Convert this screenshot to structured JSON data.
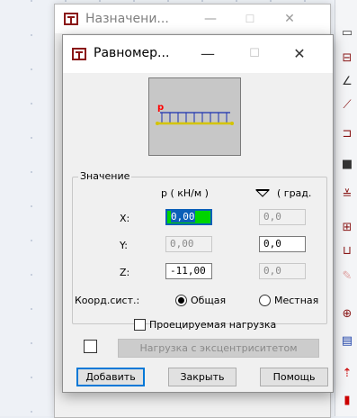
{
  "background_window": {
    "title": "Назначени..."
  },
  "dialog": {
    "title": "Равномер...",
    "preview": {
      "load_symbol": "p"
    },
    "group": {
      "label": "Значение",
      "col_p_header": "p  ( кН/м )",
      "col_angle_header": "( град.",
      "rows": [
        {
          "axis": "X:",
          "p_value": "0,00",
          "angle_value": "0,0"
        },
        {
          "axis": "Y:",
          "p_value": "0,00",
          "angle_value": "0,0"
        },
        {
          "axis": "Z:",
          "p_value": "-11,00",
          "angle_value": "0,0"
        }
      ]
    },
    "coord_system": {
      "label": "Коорд.сист.:",
      "option_general": "Общая",
      "option_local": "Местная",
      "selected": "Общая"
    },
    "projected_load_label": "Проецируемая нагрузка",
    "eccentric_button": "Нагрузка с эксцентриситетом",
    "buttons": {
      "add": "Добавить",
      "close": "Закрыть",
      "help": "Помощь"
    }
  },
  "colors": {
    "active_field": "#00d400",
    "selection": "#0b5fb8",
    "load_arrows": "#1a2fb0",
    "beam": "#d4c400",
    "load_label": "#ff0000"
  }
}
